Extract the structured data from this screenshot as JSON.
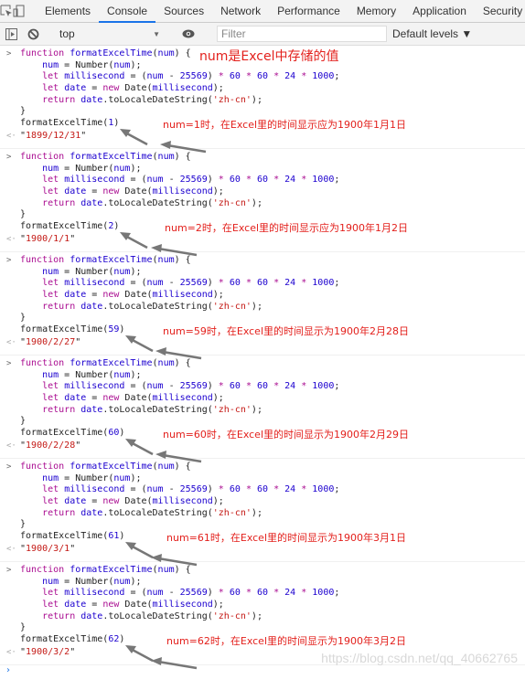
{
  "devtools": {
    "tabs": [
      "Elements",
      "Console",
      "Sources",
      "Network",
      "Performance",
      "Memory",
      "Application",
      "Security"
    ],
    "active_tab": "Console",
    "context": "top",
    "filter_placeholder": "Filter",
    "levels": "Default levels ▼"
  },
  "code_lines": [
    "function formatExcelTime(num) {",
    "    num = Number(num);",
    "    let millisecond = (num - 25569) * 60 * 60 * 24 * 1000;",
    "    let date = new Date(millisecond);",
    "    return date.toLocaleDateString('zh-cn');",
    "}"
  ],
  "header_annotation": "num是Excel中存储的值",
  "entries": [
    {
      "arg": "1",
      "result": "\"1899/12/31\"",
      "note": "num=1时，在Excel里的时间显示应为1900年1月1日"
    },
    {
      "arg": "2",
      "result": "\"1900/1/1\"",
      "note": "num=2时，在Excel里的时间显示应为1900年1月2日"
    },
    {
      "arg": "59",
      "result": "\"1900/2/27\"",
      "note": "num=59时，在Excel里的时间显示为1900年2月28日"
    },
    {
      "arg": "60",
      "result": "\"1900/2/28\"",
      "note": "num=60时，在Excel里的时间显示为1900年2月29日"
    },
    {
      "arg": "61",
      "result": "\"1900/3/1\"",
      "note": "num=61时，在Excel里的时间显示为1900年3月1日"
    },
    {
      "arg": "62",
      "result": "\"1900/3/2\"",
      "note": "num=62时，在Excel里的时间显示为1900年3月2日"
    }
  ],
  "call_name": "formatExcelTime",
  "watermark": "https://blog.csdn.net/qq_40662765",
  "icons": {
    "inspect": "inspect-element-icon",
    "device": "device-toggle-icon",
    "sidebar": "sidebar-toggle-icon",
    "clear": "clear-console-icon",
    "eye": "live-expression-icon"
  }
}
